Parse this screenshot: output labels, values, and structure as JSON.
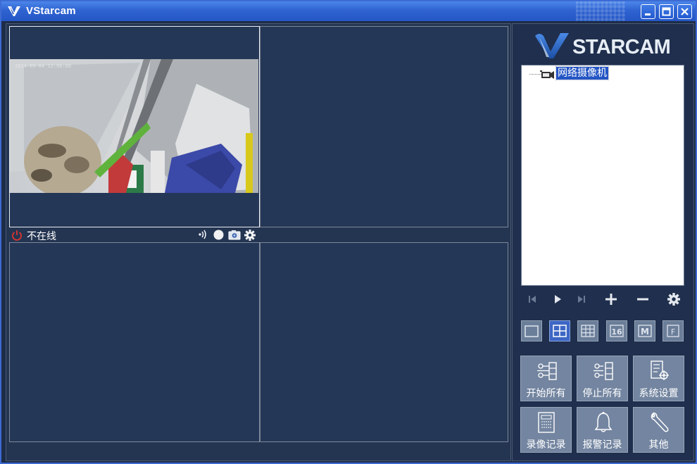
{
  "window": {
    "title": "VStarcam"
  },
  "status": {
    "text": "不在线"
  },
  "brand": {
    "text": "STARCAM"
  },
  "tree": {
    "camera_label": "网络摄像机"
  },
  "buttons": {
    "start_all": "开始所有",
    "stop_all": "停止所有",
    "system_settings": "系统设置",
    "record_log": "录像记录",
    "alarm_log": "报警记录",
    "other": "其他"
  },
  "layout_buttons": [
    "1",
    "4",
    "9",
    "16",
    "M",
    "F"
  ],
  "colors": {
    "titlebar": "#2f63d1",
    "panel_bg": "#253756",
    "accent_selected": "#2455c4",
    "power_red": "#e0342e"
  },
  "icons": {
    "power": "power-icon",
    "speaker": "speaker-icon",
    "record": "record-icon",
    "snapshot": "camera-icon",
    "settings": "gear-icon"
  }
}
